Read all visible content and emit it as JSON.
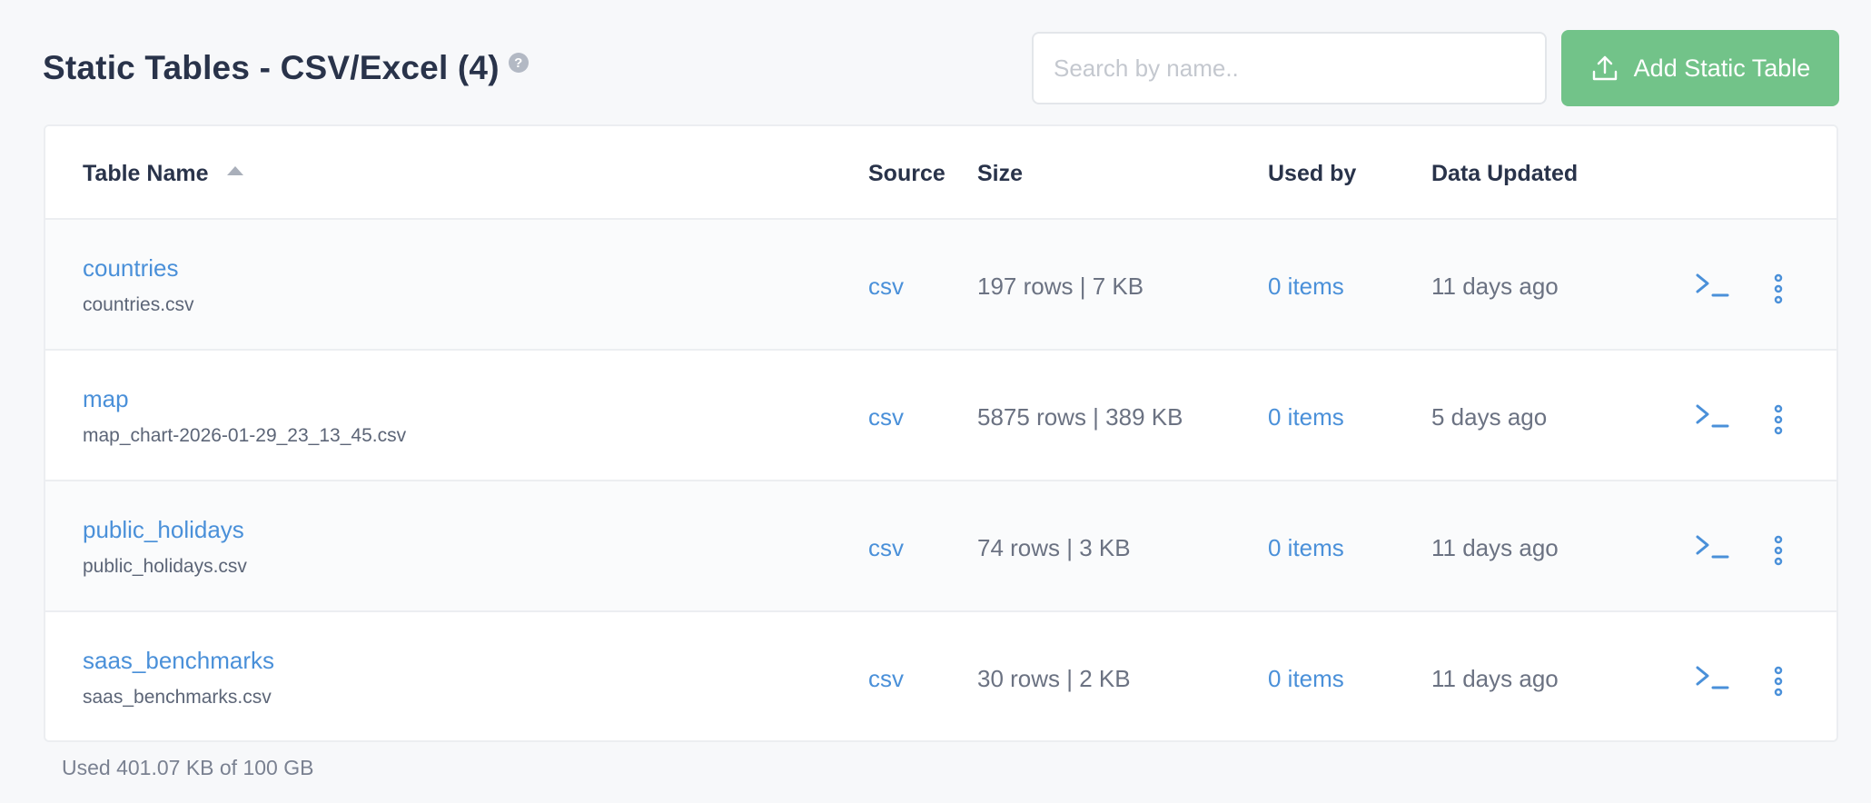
{
  "header": {
    "title": "Static Tables - CSV/Excel (4)",
    "help_glyph": "?",
    "search_placeholder": "Search by name..",
    "add_button_label": "Add Static Table",
    "add_button_color": "#72c389"
  },
  "table": {
    "columns": {
      "name": "Table Name",
      "source": "Source",
      "size": "Size",
      "used_by": "Used by",
      "updated": "Data Updated"
    },
    "sort": {
      "column": "name",
      "direction": "ascending"
    },
    "rows": [
      {
        "name": "countries",
        "file": "countries.csv",
        "source": "csv",
        "size": "197 rows | 7 KB",
        "used_by": "0 items",
        "updated": "11 days ago"
      },
      {
        "name": "map",
        "file": "map_chart-2026-01-29_23_13_45.csv",
        "source": "csv",
        "size": "5875 rows | 389 KB",
        "used_by": "0 items",
        "updated": "5 days ago"
      },
      {
        "name": "public_holidays",
        "file": "public_holidays.csv",
        "source": "csv",
        "size": "74 rows | 3 KB",
        "used_by": "0 items",
        "updated": "11 days ago"
      },
      {
        "name": "saas_benchmarks",
        "file": "saas_benchmarks.csv",
        "source": "csv",
        "size": "30 rows | 2 KB",
        "used_by": "0 items",
        "updated": "11 days ago"
      }
    ],
    "row_icons": [
      "console-icon",
      "more-vertical-icon"
    ]
  },
  "footer": {
    "usage_text": "Used 401.07 KB of 100 GB"
  },
  "colors": {
    "link": "#4a90d9",
    "title": "#29334a",
    "muted": "#6b7282",
    "background": "#f7f8fa"
  }
}
